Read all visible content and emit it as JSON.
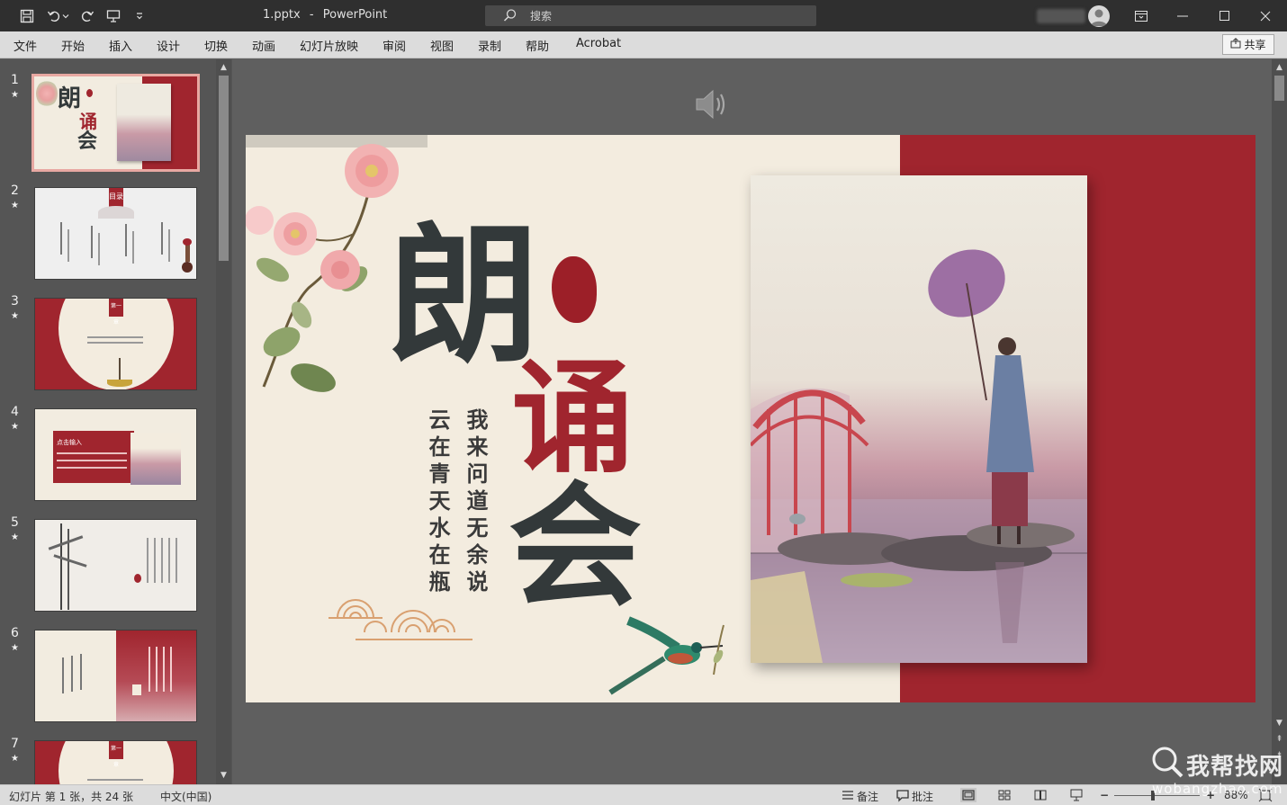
{
  "titlebar": {
    "document_title": "1.pptx",
    "separator": "-",
    "app_name": "PowerPoint",
    "search_placeholder": "搜索"
  },
  "ribbon": {
    "tabs": [
      "文件",
      "开始",
      "插入",
      "设计",
      "切换",
      "动画",
      "幻灯片放映",
      "审阅",
      "视图",
      "录制",
      "帮助",
      "Acrobat"
    ],
    "share_label": "共享"
  },
  "thumbnails": [
    {
      "number": "1",
      "star": "★"
    },
    {
      "number": "2",
      "star": "★"
    },
    {
      "number": "3",
      "star": "★"
    },
    {
      "number": "4",
      "star": "★"
    },
    {
      "number": "5",
      "star": "★"
    },
    {
      "number": "6",
      "star": "★"
    },
    {
      "number": "7",
      "star": "★"
    }
  ],
  "thumb_texts": {
    "toc": "目录",
    "chapter1": "第一章",
    "click_input": "点击输入"
  },
  "slide": {
    "char1": "朗",
    "char2": "诵",
    "char3": "会",
    "poem_col1": "我来问道无余说",
    "poem_col2": "云在青天水在瓶"
  },
  "statusbar": {
    "slide_info": "幻灯片 第 1 张，共 24 张",
    "language": "中文(中国)",
    "notes_label": "备注",
    "comments_label": "批注",
    "zoom": "88%"
  },
  "watermark": {
    "brand": "我帮找网",
    "url": "wobangzhao.com"
  },
  "colors": {
    "accent_red": "#a0252e",
    "slide_bg": "#f3ecdf",
    "title_dark": "#33393a"
  }
}
